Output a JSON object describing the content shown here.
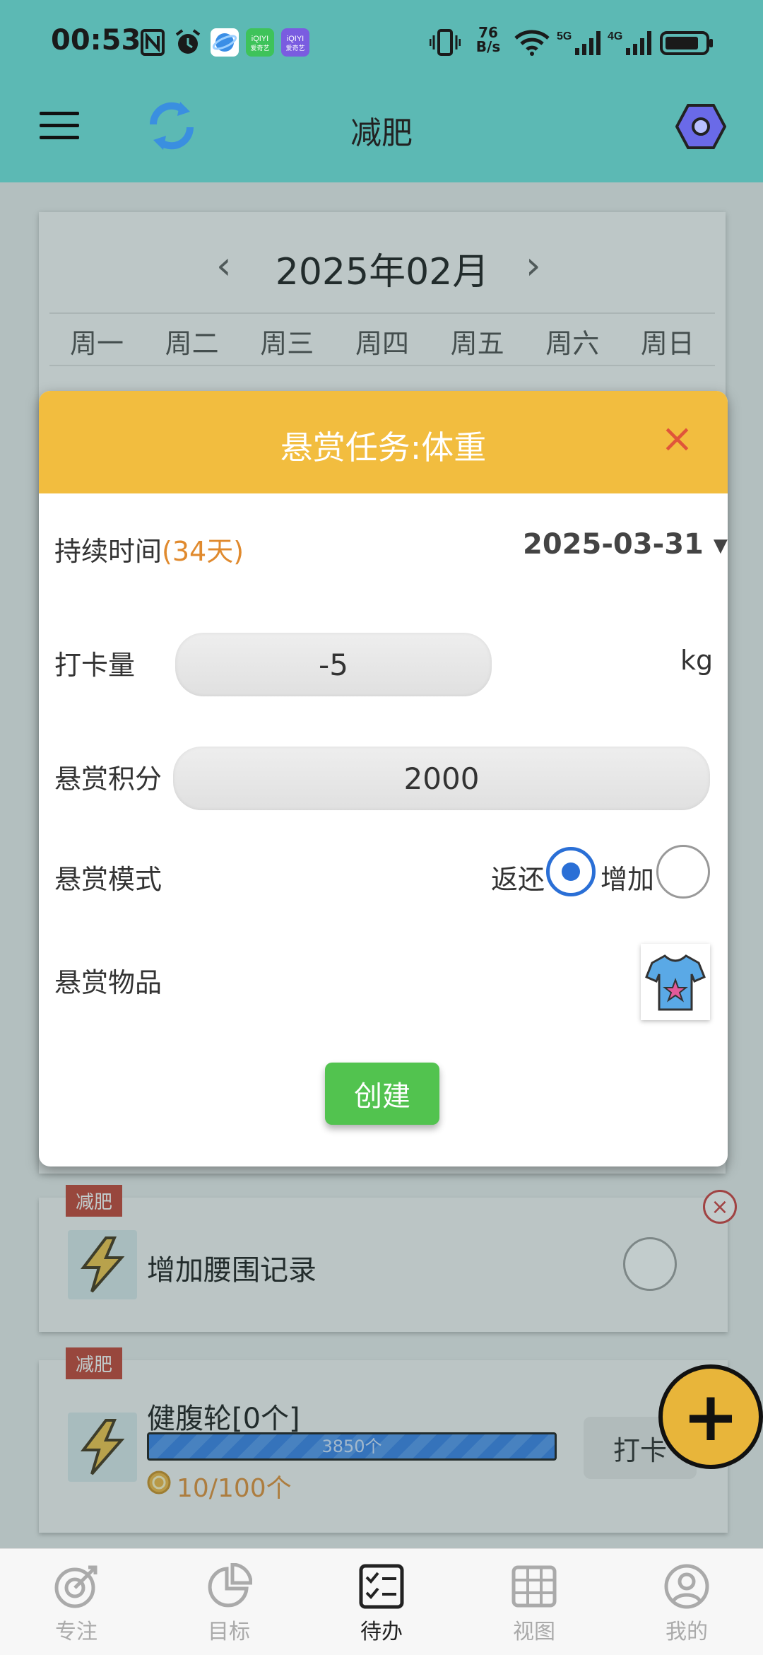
{
  "status_bar": {
    "time": "00:53",
    "net_speed": "76\nB/s",
    "icons": [
      "nfc-icon",
      "alarm-icon",
      "browser-icon",
      "iqiyi-icon",
      "iqiyi-icon",
      "vibrate-icon",
      "wifi-icon",
      "5g-signal-icon",
      "4g-signal-icon",
      "battery-icon"
    ]
  },
  "app_bar": {
    "title": "减肥",
    "menu_icon": "menu-icon",
    "sync_icon": "sync-icon",
    "settings_icon": "settings-icon"
  },
  "calendar": {
    "month": "2025年02月",
    "prev": "‹",
    "next": "›",
    "weekdays": [
      "周一",
      "周二",
      "周三",
      "周四",
      "周五",
      "周六",
      "周日"
    ]
  },
  "dialog": {
    "title": "悬赏任务:体重",
    "close": "×",
    "duration_label": "持续时间",
    "duration_days": "(34天)",
    "end_date": "2025-03-31",
    "checkin_amount_label": "打卡量",
    "checkin_amount_value": "-5",
    "checkin_unit": "kg",
    "reward_points_label": "悬赏积分",
    "reward_points_value": "2000",
    "reward_mode_label": "悬赏模式",
    "mode_return": "返还",
    "mode_add": "增加",
    "selected_mode": "返还",
    "reward_item_label": "悬赏物品",
    "create_button": "创建"
  },
  "tasks": [
    {
      "tag": "减肥",
      "title": "增加腰围记录"
    },
    {
      "tag": "减肥",
      "title": "健腹轮[0个]",
      "progress_text": "3850个",
      "coins": "10/100个",
      "checkin": "打卡"
    }
  ],
  "fab": "+",
  "bottom_nav": [
    {
      "label": "专注",
      "icon": "focus-icon",
      "active": false
    },
    {
      "label": "目标",
      "icon": "pie-chart-icon",
      "active": false
    },
    {
      "label": "待办",
      "icon": "checklist-icon",
      "active": true
    },
    {
      "label": "视图",
      "icon": "grid-icon",
      "active": false
    },
    {
      "label": "我的",
      "icon": "profile-icon",
      "active": false
    }
  ],
  "colors": {
    "app_bar": "#5cb9b4",
    "dialog_header": "#f2bd3f",
    "accent_orange": "#e08a2e",
    "create_green": "#52c34f",
    "radio_blue": "#2a6fd6",
    "tag_red": "#c0392b"
  }
}
